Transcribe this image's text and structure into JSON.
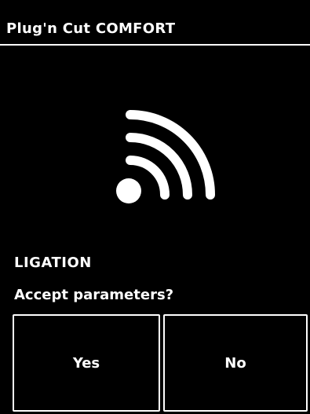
{
  "header": {
    "title": "Plug'n Cut COMFORT"
  },
  "status": {
    "icon": "wireless-signal-icon",
    "mode": "LIGATION",
    "prompt": "Accept parameters?"
  },
  "actions": {
    "yes_label": "Yes",
    "no_label": "No"
  },
  "colors": {
    "background": "#000000",
    "foreground": "#ffffff"
  }
}
